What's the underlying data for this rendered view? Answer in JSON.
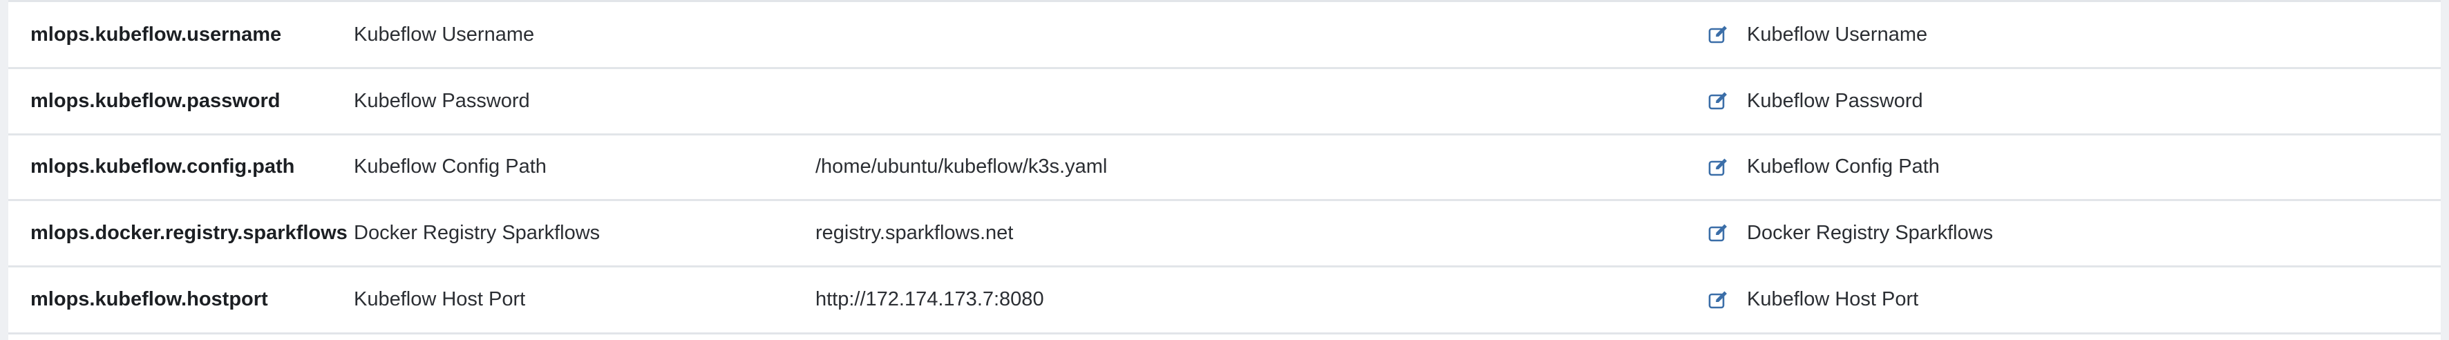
{
  "accent_color": "#3b6ea8",
  "edit_icon": "edit-icon",
  "rows": [
    {
      "key": "mlops.kubeflow.username",
      "label": "Kubeflow Username",
      "value": "",
      "description": "Kubeflow Username"
    },
    {
      "key": "mlops.kubeflow.password",
      "label": "Kubeflow Password",
      "value": "",
      "description": "Kubeflow Password"
    },
    {
      "key": "mlops.kubeflow.config.path",
      "label": "Kubeflow Config Path",
      "value": "/home/ubuntu/kubeflow/k3s.yaml",
      "description": "Kubeflow Config Path"
    },
    {
      "key": "mlops.docker.registry.sparkflows",
      "label": "Docker Registry Sparkflows",
      "value": "registry.sparkflows.net",
      "description": "Docker Registry Sparkflows"
    },
    {
      "key": "mlops.kubeflow.hostport",
      "label": "Kubeflow Host Port",
      "value": "http://172.174.173.7:8080",
      "description": "Kubeflow Host Port"
    }
  ]
}
